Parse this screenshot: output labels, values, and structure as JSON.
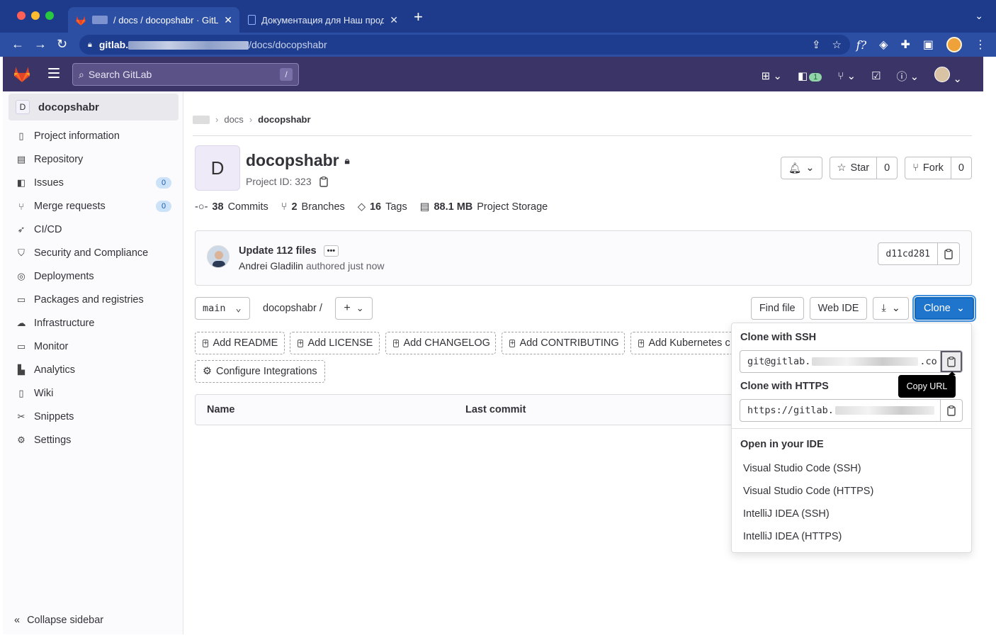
{
  "browser": {
    "tabs": [
      {
        "title": "/ docs / docopshabr · GitLab"
      },
      {
        "title": "Документация для Наш продукт"
      }
    ],
    "url_host": "gitlab.",
    "url_path": "/docs/docopshabr"
  },
  "header": {
    "search_placeholder": "Search GitLab",
    "search_shortcut": "/",
    "mr_count": "1"
  },
  "sidebar": {
    "project_initial": "D",
    "project_name": "docopshabr",
    "items": [
      {
        "label": "Project information",
        "icon": "info-icon"
      },
      {
        "label": "Repository",
        "icon": "doc-icon"
      },
      {
        "label": "Issues",
        "icon": "issues-icon",
        "badge": "0"
      },
      {
        "label": "Merge requests",
        "icon": "merge-request-icon",
        "badge": "0"
      },
      {
        "label": "CI/CD",
        "icon": "rocket-icon"
      },
      {
        "label": "Security and Compliance",
        "icon": "shield-icon"
      },
      {
        "label": "Deployments",
        "icon": "deployments-icon"
      },
      {
        "label": "Packages and registries",
        "icon": "package-icon"
      },
      {
        "label": "Infrastructure",
        "icon": "cloud-gear-icon"
      },
      {
        "label": "Monitor",
        "icon": "monitor-icon"
      },
      {
        "label": "Analytics",
        "icon": "chart-icon"
      },
      {
        "label": "Wiki",
        "icon": "book-icon"
      },
      {
        "label": "Snippets",
        "icon": "scissors-icon"
      },
      {
        "label": "Settings",
        "icon": "gear-icon"
      }
    ],
    "collapse_label": "Collapse sidebar"
  },
  "breadcrumb": {
    "group": "docs",
    "current": "docopshabr"
  },
  "project": {
    "initial": "D",
    "name": "docopshabr",
    "id_label": "Project ID: 323",
    "star_label": "Star",
    "star_count": "0",
    "fork_label": "Fork",
    "fork_count": "0"
  },
  "stats": {
    "commits_num": "38",
    "commits_label": "Commits",
    "branches_num": "2",
    "branches_label": "Branches",
    "tags_num": "16",
    "tags_label": "Tags",
    "storage_num": "88.1 MB",
    "storage_label": "Project Storage"
  },
  "commit": {
    "title": "Update 112 files",
    "ellipsis": "•••",
    "author": "Andrei Gladilin",
    "meta": "authored just now",
    "sha": "d11cd281"
  },
  "tree": {
    "branch": "main",
    "path": "docopshabr",
    "path_sep": "/",
    "find_file": "Find file",
    "web_ide": "Web IDE",
    "clone": "Clone"
  },
  "suggestions": [
    "Add README",
    "Add LICENSE",
    "Add CHANGELOG",
    "Add CONTRIBUTING",
    "Add Kubernetes c",
    "Configure Integrations"
  ],
  "table": {
    "col_name": "Name",
    "col_last_commit": "Last commit"
  },
  "clone_dropdown": {
    "ssh_header": "Clone with SSH",
    "ssh_prefix": "git@gitlab.",
    "ssh_suffix": ".co",
    "https_header": "Clone with HTTPS",
    "https_prefix": "https://gitlab.",
    "ide_header": "Open in your IDE",
    "ide_items": [
      "Visual Studio Code (SSH)",
      "Visual Studio Code (HTTPS)",
      "IntelliJ IDEA (SSH)",
      "IntelliJ IDEA (HTTPS)"
    ],
    "tooltip": "Copy URL"
  },
  "colors": {
    "header_bg": "#3b3467",
    "clone_blue": "#1f75cb",
    "chrome_blue": "#1d3b8a"
  }
}
